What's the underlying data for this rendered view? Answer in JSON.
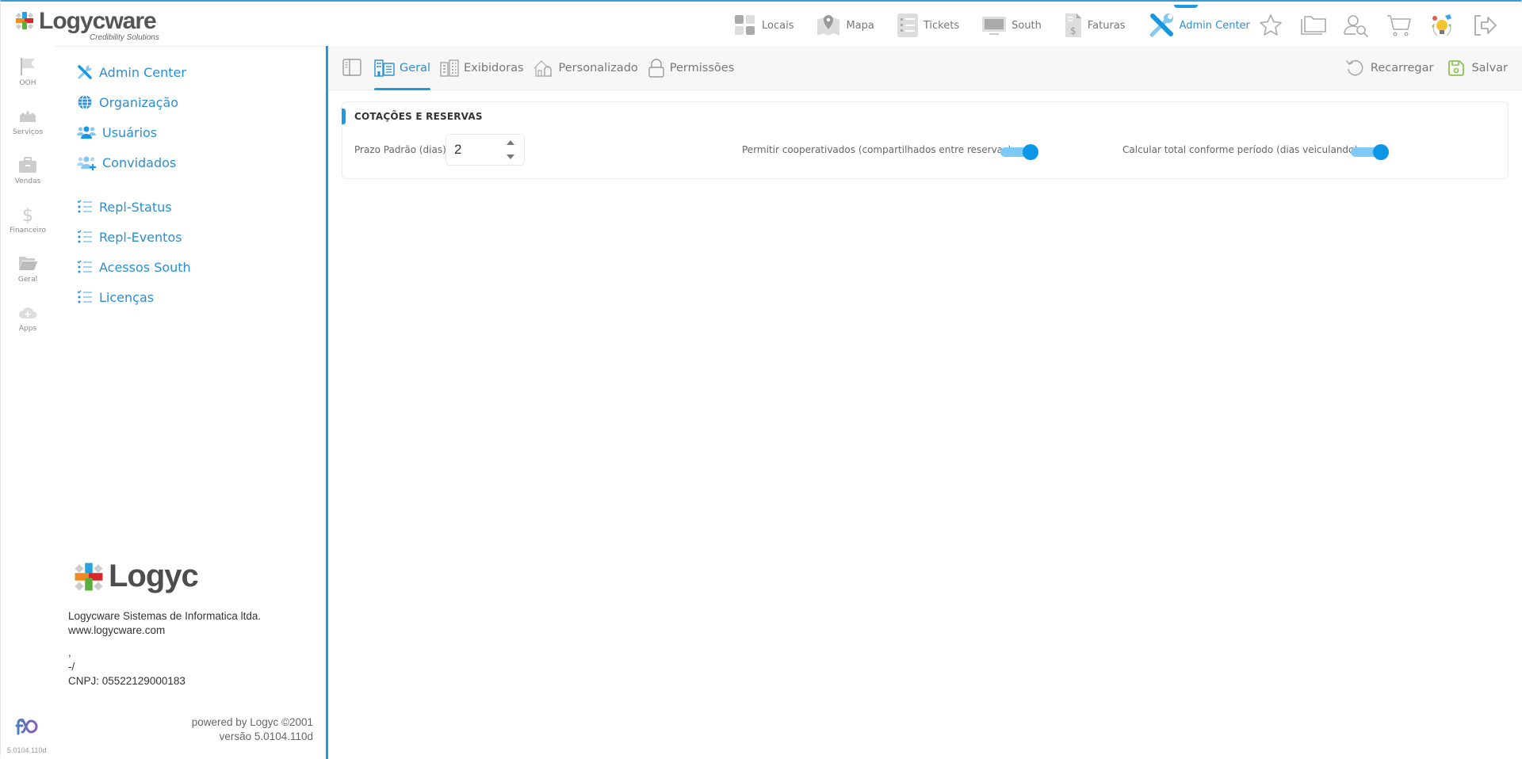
{
  "app": {
    "brand_name": "Logycware",
    "brand_tagline": "Credibility Solutions"
  },
  "top_nav": {
    "items": [
      {
        "label": "Locais",
        "icon": "grid-icon",
        "active": false
      },
      {
        "label": "Mapa",
        "icon": "map-pin-icon",
        "active": false
      },
      {
        "label": "Tickets",
        "icon": "checklist-icon",
        "active": false
      },
      {
        "label": "South",
        "icon": "monitor-icon",
        "active": false
      },
      {
        "label": "Faturas",
        "icon": "invoice-icon",
        "active": false
      },
      {
        "label": "Admin Center",
        "icon": "tools-icon",
        "active": true
      }
    ],
    "tools": [
      "star-icon",
      "folders-icon",
      "user-search-icon",
      "cart-icon",
      "idea-icon",
      "logout-icon"
    ]
  },
  "rail": {
    "items": [
      {
        "label": "OOH",
        "icon": "flag-icon"
      },
      {
        "label": "Serviços",
        "icon": "crown-icon"
      },
      {
        "label": "Vendas",
        "icon": "briefcase-icon"
      },
      {
        "label": "Financeiro",
        "icon": "dollar-icon"
      },
      {
        "label": "Geral",
        "icon": "folder-icon"
      },
      {
        "label": "Apps",
        "icon": "cloud-plus-icon"
      }
    ],
    "version": "5.0104.110d"
  },
  "sidebar": {
    "items": [
      {
        "label": "Admin Center",
        "icon": "tools-icon"
      },
      {
        "label": "Organização",
        "icon": "globe-icon"
      },
      {
        "label": "Usuários",
        "icon": "users-icon"
      },
      {
        "label": "Convidados",
        "icon": "users-plus-icon"
      },
      {
        "label": "Repl-Status",
        "icon": "checklist-icon"
      },
      {
        "label": "Repl-Eventos",
        "icon": "checklist-icon"
      },
      {
        "label": "Acessos South",
        "icon": "checklist-icon"
      },
      {
        "label": "Licenças",
        "icon": "checklist-icon"
      }
    ],
    "footer_logo_text": "Logyc",
    "company": {
      "name": "Logycware Sistemas de Informatica ltda.",
      "website": "www.logycware.com",
      "line3": ",",
      "line4": "-/",
      "cnpj": "CNPJ: 05522129000183"
    },
    "powered_by": "powered by Logyc ©2001",
    "version": "versão 5.0104.110d"
  },
  "tabs": {
    "items": [
      {
        "label": "Geral",
        "icon": "building-list-icon",
        "active": true
      },
      {
        "label": "Exibidoras",
        "icon": "buildings-icon",
        "active": false
      },
      {
        "label": "Personalizado",
        "icon": "houses-icon",
        "active": false
      },
      {
        "label": "Permissões",
        "icon": "lock-icon",
        "active": false
      }
    ],
    "actions": {
      "reload_label": "Recarregar",
      "save_label": "Salvar"
    }
  },
  "section": {
    "title": "COTAÇÕES E RESERVAS",
    "prazo_label": "Prazo Padrão (dias)",
    "prazo_value": "2",
    "coop_label": "Permitir cooperativados (compartilhados entre reservas)",
    "coop_enabled": true,
    "calc_label": "Calcular total conforme período (dias veiculando)",
    "calc_enabled": true
  },
  "colors": {
    "accent": "#1e9be0",
    "link": "#2a8ed6",
    "save_green": "#8cc152"
  }
}
